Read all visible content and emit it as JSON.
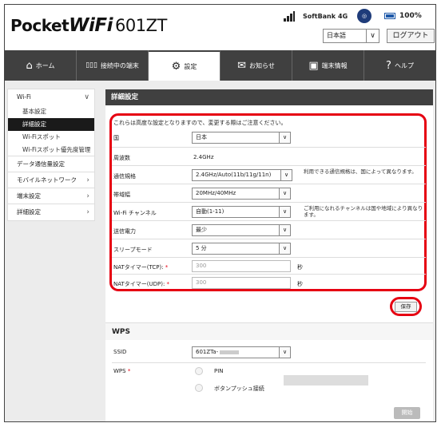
{
  "header": {
    "logo_pocket": "Pocket",
    "logo_wifi": "WiFi",
    "logo_model": "601ZT",
    "carrier": "SoftBank",
    "network": "4G",
    "battery": "100%",
    "language": "日本語",
    "logout": "ログアウト"
  },
  "nav": {
    "tabs": [
      {
        "label": "ホーム",
        "icon": "⌂"
      },
      {
        "label": "接続中の端末",
        "icon": "▯▯▯"
      },
      {
        "label": "設定",
        "icon": "⚙"
      },
      {
        "label": "お知らせ",
        "icon": "✉"
      },
      {
        "label": "端末情報",
        "icon": "▣"
      },
      {
        "label": "ヘルプ",
        "icon": "?"
      }
    ]
  },
  "sidebar": {
    "wifi": "Wi-Fi",
    "wifi_items": [
      "基本設定",
      "詳細設定",
      "Wi-Fiスポット",
      "Wi-Fiスポット優先度管理"
    ],
    "data": "データ通信量設定",
    "mobile": "モバイルネットワーク",
    "device": "端末設定",
    "advanced": "詳細設定"
  },
  "panel": {
    "title": "詳細設定",
    "notice": "これらは高度な設定となりますので、変更する際はご注意ください。",
    "rows": {
      "country_label": "国",
      "country_value": "日本",
      "freq_label": "周波数",
      "freq_value": "2.4GHz",
      "std_label": "通信規格",
      "std_value": "2.4GHz/Auto(11b/11g/11n)",
      "std_note": "利用できる通信規格は、国によって異なります。",
      "bw_label": "帯域幅",
      "bw_value": "20MHz/40MHz",
      "ch_label": "Wi-Fi チャンネル",
      "ch_value": "自動(1-11)",
      "ch_note": "ご利用になれるチャンネルは国や地域により異なります。",
      "tx_label": "送信電力",
      "tx_value": "最少",
      "sleep_label": "スリープモード",
      "sleep_value": "5 分",
      "tcp_label": "NATタイマー(TCP):",
      "tcp_value": "300",
      "udp_label": "NATタイマー(UDP):",
      "udp_value": "300",
      "sec": "秒",
      "required": "*"
    },
    "save": "保存"
  },
  "wps": {
    "title": "WPS",
    "ssid_label": "SSID",
    "ssid_value": "601ZTa-",
    "wps_label": "WPS",
    "pin": "PIN",
    "push": "ボタンプッシュ接続",
    "start": "開始"
  }
}
